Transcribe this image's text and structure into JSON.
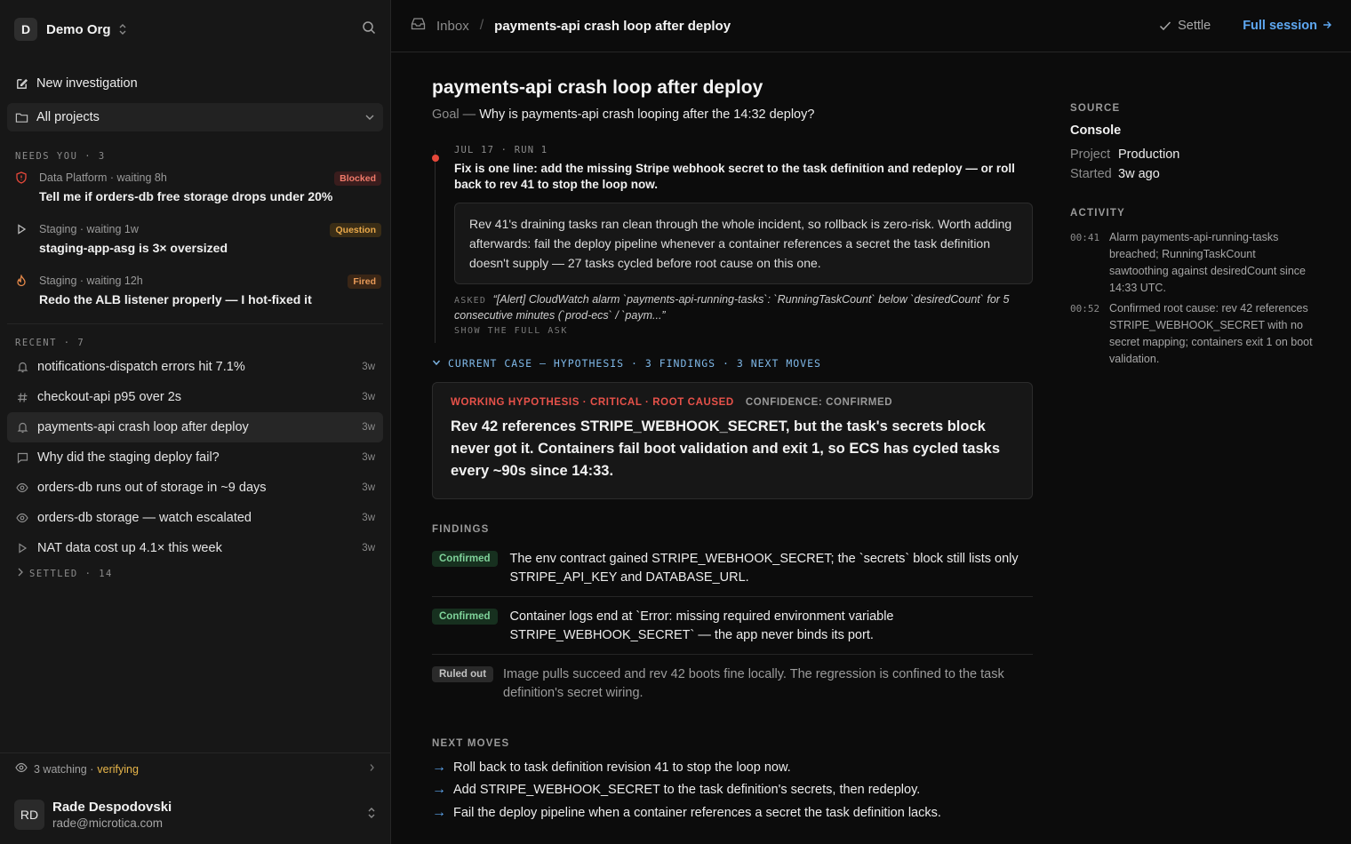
{
  "sidebar": {
    "org_initial": "D",
    "org_name": "Demo Org",
    "new_investigation": "New investigation",
    "projects_filter": "All projects",
    "needs_you_header": "NEEDS YOU · 3",
    "needs_you": [
      {
        "context": "Data Platform · waiting 8h",
        "title": "Tell me if orders-db free storage drops under 20%",
        "badge": "Blocked",
        "icon": "shield-alert-icon"
      },
      {
        "context": "Staging · waiting 1w",
        "title": "staging-app-asg is 3× oversized",
        "badge": "Question",
        "icon": "play-icon"
      },
      {
        "context": "Staging · waiting 12h",
        "title": "Redo the ALB listener properly — I hot-fixed it",
        "badge": "Fired",
        "icon": "flame-icon"
      }
    ],
    "recent_header": "RECENT · 7",
    "recent": [
      {
        "label": "notifications-dispatch errors hit 7.1%",
        "age": "3w",
        "icon": "bell-icon"
      },
      {
        "label": "checkout-api p95 over 2s",
        "age": "3w",
        "icon": "hash-icon"
      },
      {
        "label": "payments-api crash loop after deploy",
        "age": "3w",
        "icon": "bell-icon"
      },
      {
        "label": "Why did the staging deploy fail?",
        "age": "3w",
        "icon": "message-icon"
      },
      {
        "label": "orders-db runs out of storage in ~9 days",
        "age": "3w",
        "icon": "eye-icon"
      },
      {
        "label": "orders-db storage — watch escalated",
        "age": "3w",
        "icon": "eye-icon"
      },
      {
        "label": "NAT data cost up 4.1× this week",
        "age": "3w",
        "icon": "play-icon"
      }
    ],
    "settled_header": "SETTLED · 14",
    "watch_count": "3 watching ·",
    "watch_status": "verifying",
    "user_initials": "RD",
    "user_name": "Rade Despodovski",
    "user_email": "rade@microtica.com"
  },
  "topbar": {
    "inbox": "Inbox",
    "separator": "/",
    "title": "payments-api crash loop after deploy",
    "settle": "Settle",
    "full_session": "Full session"
  },
  "main": {
    "title": "payments-api crash loop after deploy",
    "goal_label": "Goal —",
    "goal": "Why is payments-api crash looping after the 14:32 deploy?",
    "run_meta": "JUL 17 · RUN 1",
    "run_summary": "Fix is one line: add the missing Stripe webhook secret to the task definition and redeploy — or roll back to rev 41 to stop the loop now.",
    "run_detail": "Rev 41's draining tasks ran clean through the whole incident, so rollback is zero-risk. Worth adding afterwards: fail the deploy pipeline whenever a container references a secret the task definition doesn't supply — 27 tasks cycled before root cause on this one.",
    "asked_label": "ASKED",
    "asked_text": "“[Alert] CloudWatch alarm `payments-api-running-tasks`: `RunningTaskCount` below `desiredCount` for 5 consecutive minutes (`prod-ecs` / `paym...”",
    "show_full": "SHOW THE FULL ASK",
    "case_header": "CURRENT CASE — HYPOTHESIS · 3 FINDINGS · 3 NEXT MOVES",
    "hypothesis_tags": "WORKING HYPOTHESIS · CRITICAL · ROOT CAUSED",
    "confidence": "CONFIDENCE: CONFIRMED",
    "hypothesis": "Rev 42 references STRIPE_WEBHOOK_SECRET, but the task's secrets block never got it. Containers fail boot validation and exit 1, so ECS has cycled tasks every ~90s since 14:33.",
    "findings_label": "FINDINGS",
    "findings": [
      {
        "status": "Confirmed",
        "text": "The env contract gained STRIPE_WEBHOOK_SECRET; the `secrets` block still lists only STRIPE_API_KEY and DATABASE_URL."
      },
      {
        "status": "Confirmed",
        "text": "Container logs end at `Error: missing required environment variable STRIPE_WEBHOOK_SECRET` — the app never binds its port."
      },
      {
        "status": "Ruled out",
        "text": "Image pulls succeed and rev 42 boots fine locally. The regression is confined to the task definition's secret wiring."
      }
    ],
    "next_moves_label": "NEXT MOVES",
    "next_moves": [
      "Roll back to task definition revision 41 to stop the loop now.",
      "Add STRIPE_WEBHOOK_SECRET to the task definition's secrets, then redeploy.",
      "Fail the deploy pipeline when a container references a secret the task definition lacks."
    ]
  },
  "panel": {
    "source_label": "SOURCE",
    "source": "Console",
    "project_key": "Project",
    "project_val": "Production",
    "started_key": "Started",
    "started_val": "3w ago",
    "activity_label": "ACTIVITY",
    "activity": [
      {
        "time": "00:41",
        "text": "Alarm payments-api-running-tasks breached; RunningTaskCount sawtoothing against desiredCount since 14:33 UTC."
      },
      {
        "time": "00:52",
        "text": "Confirmed root cause: rev 42 references STRIPE_WEBHOOK_SECRET with no secret mapping; containers exit 1 on boot validation."
      }
    ]
  },
  "colors": {
    "accent": "#5ea8f2",
    "critical": "#e8524a",
    "confirmed": "#7fd39a",
    "verifying": "#e8b64a"
  }
}
